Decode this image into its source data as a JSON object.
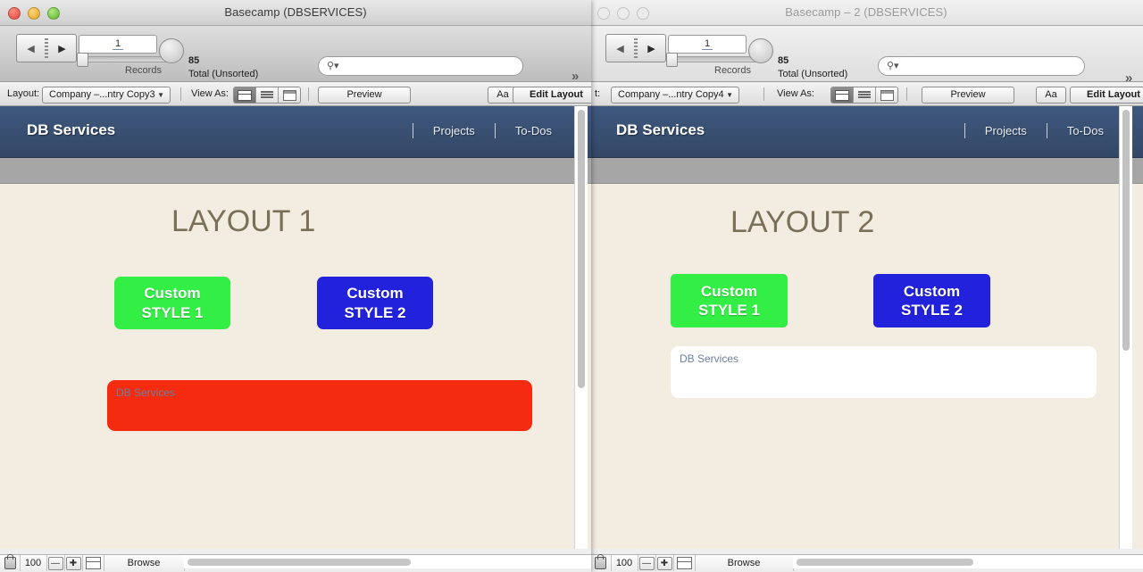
{
  "app": "FileMaker Pro",
  "windows": [
    {
      "id": "window-1",
      "title": "Basecamp (DBSERVICES)",
      "active": true,
      "toolbar": {
        "record_number": "1",
        "records_label": "Records",
        "total_count": "85",
        "total_label": "Total (Unsorted)",
        "search_placeholder": "",
        "overflow_label": "»",
        "prev_icon": "◀",
        "next_icon": "▶",
        "search_icon": "search-icon"
      },
      "layoutbar": {
        "layout_label": "Layout:",
        "layout_value": "Company –...ntry Copy3",
        "view_as_label": "View As:",
        "view_options": [
          "form-view",
          "list-view",
          "table-view"
        ],
        "view_selected": 0,
        "preview_label": "Preview",
        "text_format_label": "Aa",
        "edit_layout_label": "Edit Layout"
      },
      "nav": {
        "brand": "DB Services",
        "links": [
          "Projects",
          "To-Dos"
        ]
      },
      "page": {
        "title": "LAYOUT 1",
        "buttons": [
          {
            "line1": "Custom",
            "line2": "STYLE 1",
            "color": "#33EE44"
          },
          {
            "line1": "Custom",
            "line2": "STYLE 2",
            "color": "#2222DD"
          }
        ],
        "field": {
          "text": "DB Services",
          "color": "#F42B0E"
        }
      },
      "status": {
        "lock_icon": "lock-icon",
        "zoom_level": "100",
        "zoom_out": "—",
        "zoom_in": "✚",
        "panel_icon": "panel-toggle-icon",
        "mode": "Browse"
      }
    },
    {
      "id": "window-2",
      "title": "Basecamp – 2 (DBSERVICES)",
      "active": false,
      "toolbar": {
        "record_number": "1",
        "records_label": "Records",
        "total_count": "85",
        "total_label": "Total (Unsorted)",
        "search_placeholder": "",
        "overflow_label": "»",
        "prev_icon": "◀",
        "next_icon": "▶",
        "search_icon": "search-icon"
      },
      "layoutbar": {
        "layout_label": "t:",
        "layout_value": "Company –...ntry Copy4",
        "view_as_label": "View As:",
        "view_options": [
          "form-view",
          "list-view",
          "table-view"
        ],
        "view_selected": 0,
        "preview_label": "Preview",
        "text_format_label": "Aa",
        "edit_layout_label": "Edit Layout"
      },
      "nav": {
        "brand": "DB Services",
        "links": [
          "Projects",
          "To-Dos"
        ]
      },
      "page": {
        "title": "LAYOUT 2",
        "buttons": [
          {
            "line1": "Custom",
            "line2": "STYLE 1",
            "color": "#33EE44"
          },
          {
            "line1": "Custom",
            "line2": "STYLE 2",
            "color": "#2222DD"
          }
        ],
        "field": {
          "text": "DB Services",
          "color": "#FFFFFF"
        }
      },
      "status": {
        "lock_icon": "lock-icon",
        "zoom_level": "100",
        "zoom_out": "—",
        "zoom_in": "✚",
        "panel_icon": "panel-toggle-icon",
        "mode": "Browse"
      }
    }
  ],
  "colors": {
    "navbar": "#3f587e",
    "content_bg": "#f3ece0",
    "subbar": "#a6a6a6",
    "title_text": "#7a6f58"
  }
}
